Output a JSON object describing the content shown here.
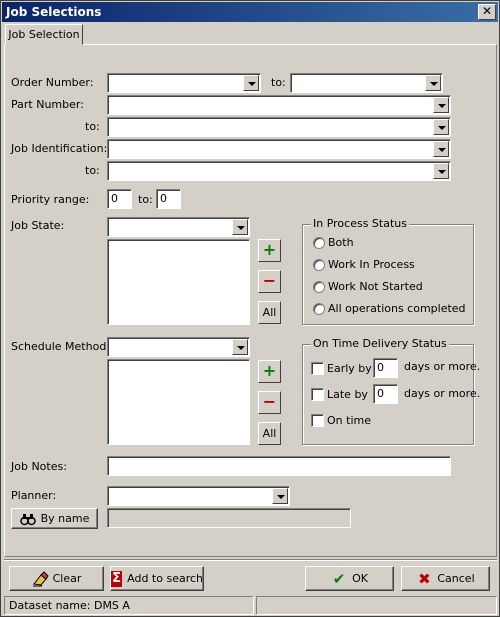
{
  "window": {
    "title": "Job Selections",
    "close_glyph": "✕"
  },
  "tabs": [
    {
      "label": "Job Selection"
    }
  ],
  "form": {
    "order_number": {
      "label": "Order Number:",
      "from_value": "",
      "to_label": "to:",
      "to_value": ""
    },
    "part_number": {
      "label": "Part Number:",
      "from_value": "",
      "to_label": "to:",
      "to_value": ""
    },
    "job_identification": {
      "label": "Job Identification:",
      "from_value": "",
      "to_label": "to:",
      "to_value": ""
    },
    "priority_range": {
      "label": "Priority range:",
      "from_value": "0",
      "to_label": "to:",
      "to_value": "0"
    },
    "job_state": {
      "label": "Job State:",
      "value": "",
      "add_label": "+",
      "remove_label": "−",
      "all_label": "All"
    },
    "schedule_method": {
      "label": "Schedule Method:",
      "value": "",
      "add_label": "+",
      "remove_label": "−",
      "all_label": "All"
    },
    "job_notes": {
      "label": "Job Notes:",
      "value": ""
    },
    "planner": {
      "label": "Planner:",
      "value": "",
      "by_name_label": "By name",
      "by_name_value": ""
    }
  },
  "in_process_status": {
    "title": "In Process Status",
    "options": [
      "Both",
      "Work In Process",
      "Work Not Started",
      "All operations completed"
    ]
  },
  "on_time_delivery": {
    "title": "On Time Delivery Status",
    "early_label": "Early by",
    "early_value": "0",
    "early_suffix": "days or more.",
    "late_label": "Late by",
    "late_value": "0",
    "late_suffix": "days or more.",
    "on_time_label": "On time"
  },
  "buttons": {
    "clear": {
      "label": "Clear",
      "icon": "eraser-icon"
    },
    "add_to_search": {
      "label": "Add to search",
      "icon": "sigma-icon",
      "icon_glyph": "Σ"
    },
    "ok": {
      "label": "OK",
      "icon": "checkmark-icon",
      "icon_glyph": "✔"
    },
    "cancel": {
      "label": "Cancel",
      "icon": "x-icon",
      "icon_glyph": "✖"
    }
  },
  "status_bar": {
    "dataset": "Dataset name:  DMS A",
    "right": ""
  },
  "colors": {
    "title_start": "#0a246a",
    "title_end": "#3a6ea5",
    "plus": "#008000",
    "minus": "#b00000",
    "cancel_x": "#c00000",
    "ok_check": "#008000",
    "sigma_bg": "#c00000"
  }
}
